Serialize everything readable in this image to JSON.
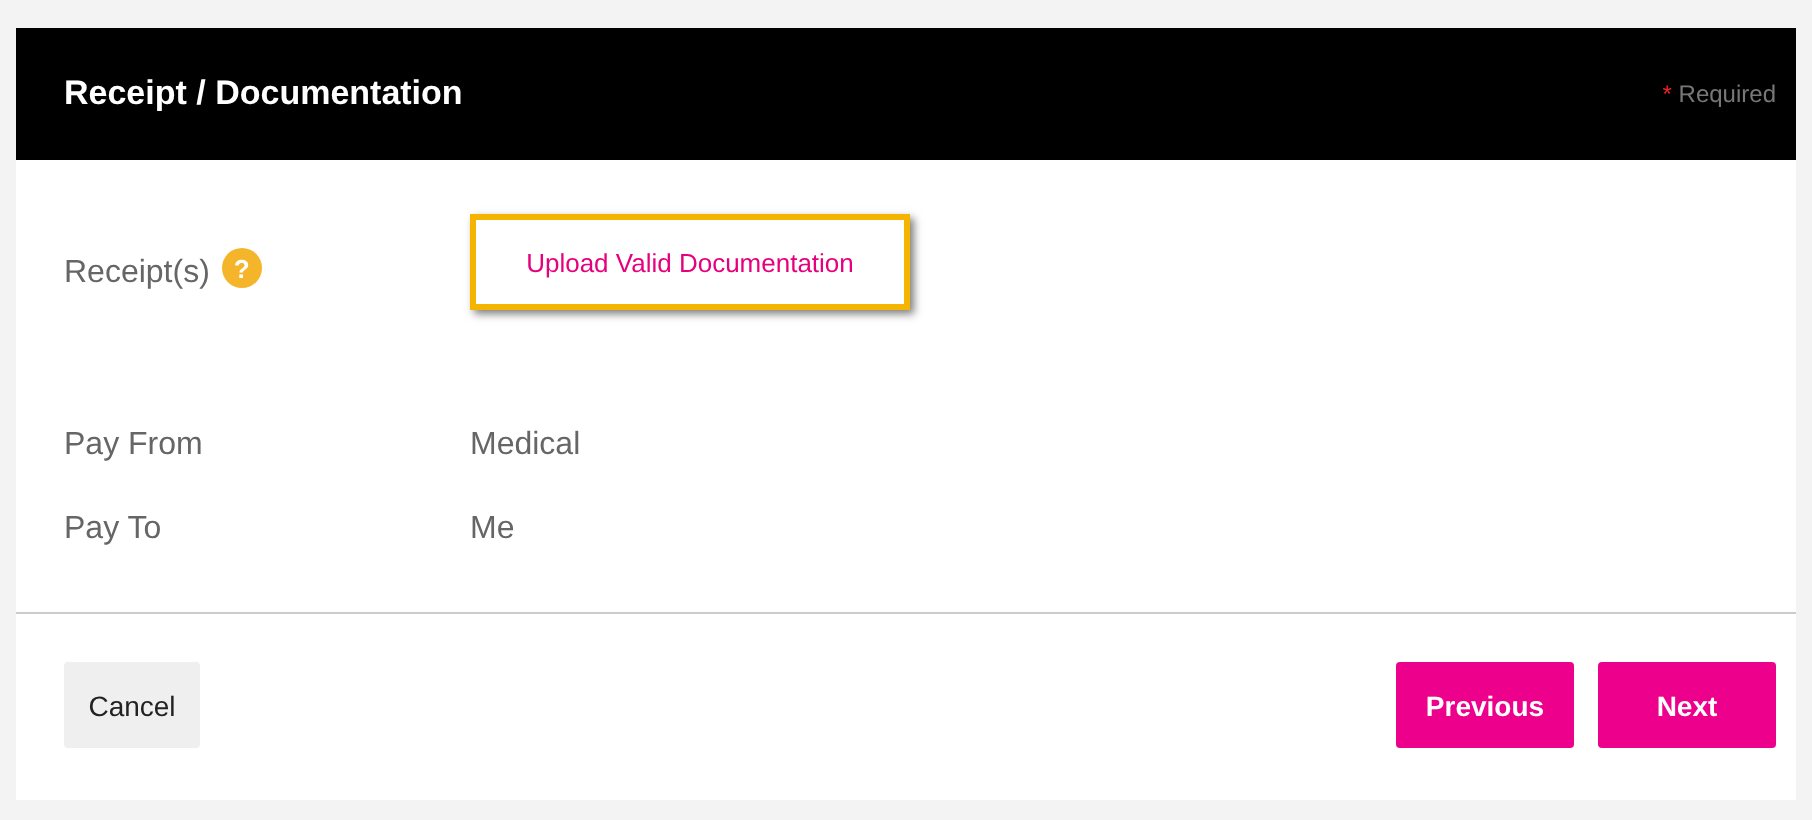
{
  "header": {
    "title": "Receipt / Documentation",
    "required_mark": "*",
    "required_label": "Required"
  },
  "receipts": {
    "label": "Receipt(s)",
    "help": "?",
    "upload_button": {
      "label": "Upload Valid Documentation",
      "focused": true
    }
  },
  "fields": [
    {
      "label": "Pay From",
      "value": "Medical"
    },
    {
      "label": "Pay To",
      "value": "Me"
    }
  ],
  "buttons": {
    "cancel": "Cancel",
    "previous": "Previous",
    "next": "Next"
  }
}
